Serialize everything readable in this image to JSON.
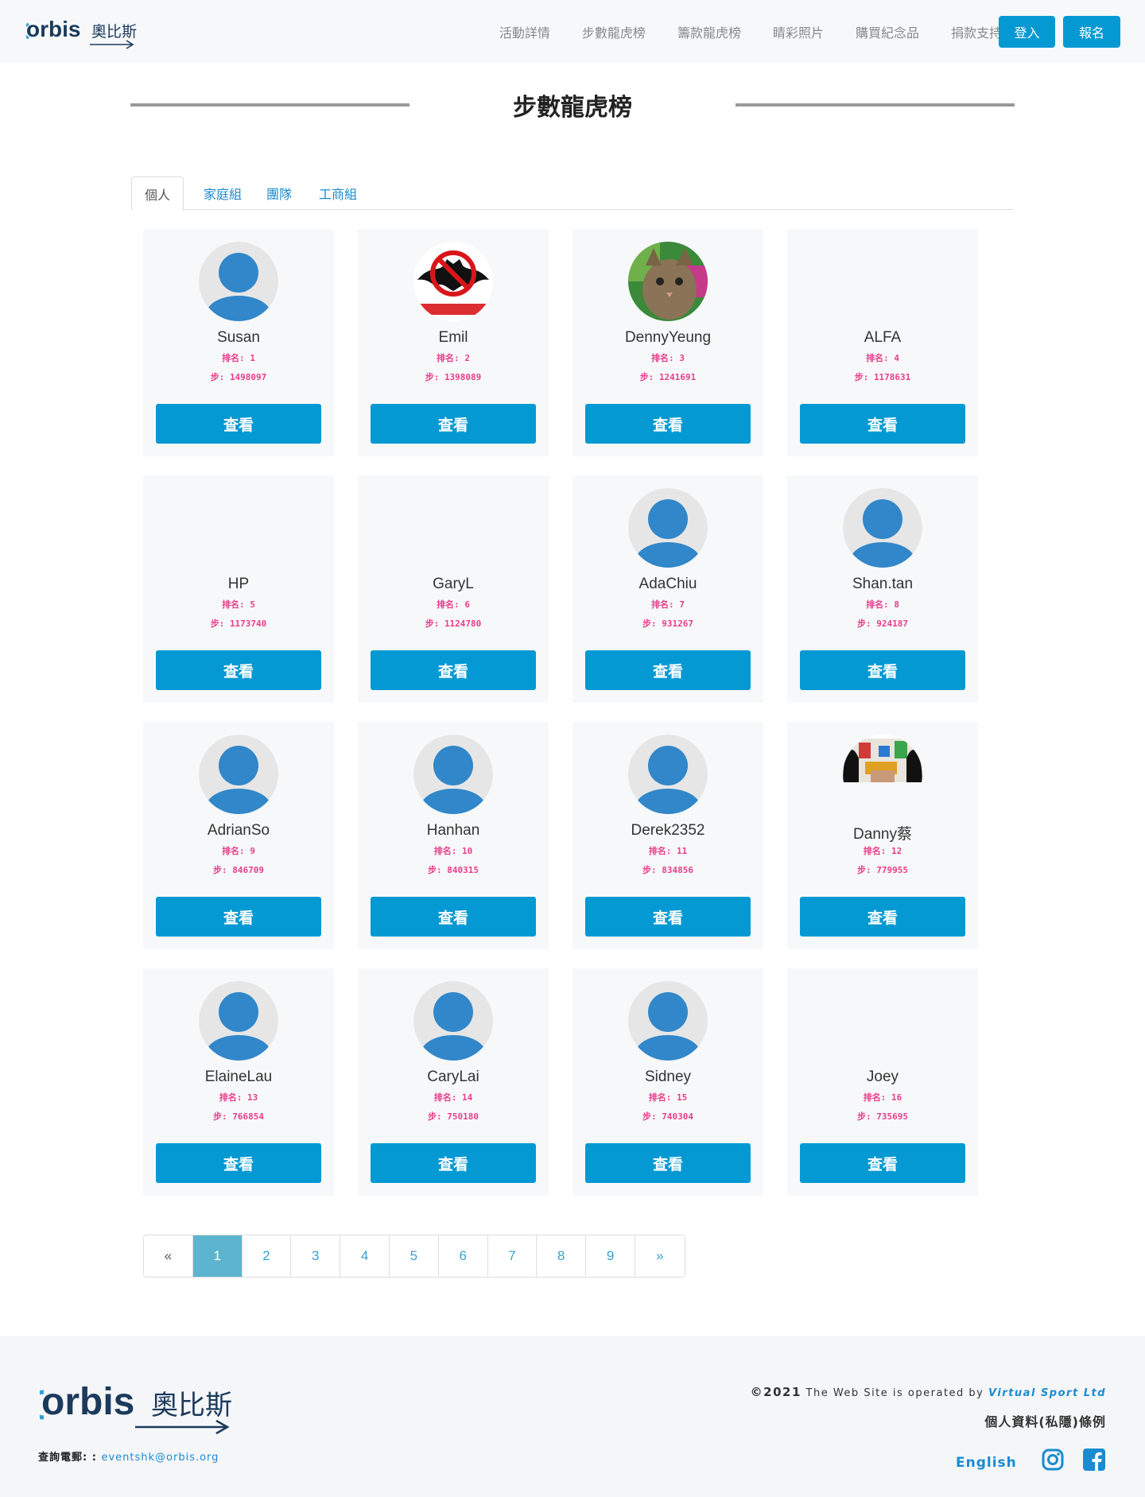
{
  "brand": {
    "wordmark": "orbis",
    "chinese": "奧比斯"
  },
  "nav": {
    "links": [
      "活動詳情",
      "步數龍虎榜",
      "籌款龍虎榜",
      "睛彩照片",
      "購買紀念品",
      "捐款支持"
    ],
    "login": "登入",
    "signup": "報名"
  },
  "page_title": "步數龍虎榜",
  "tabs": [
    "個人",
    "家庭組",
    "團隊",
    "工商組"
  ],
  "active_tab": "個人",
  "rank_label": "排名:",
  "steps_label": "步:",
  "view_button": "查看",
  "cards": [
    {
      "name": "Susan",
      "rank": "1",
      "steps": "1498097",
      "avatar": "default"
    },
    {
      "name": "Emil",
      "rank": "2",
      "steps": "1398089",
      "avatar": "bat-photo"
    },
    {
      "name": "DennyYeung",
      "rank": "3",
      "steps": "1241691",
      "avatar": "cat-photo"
    },
    {
      "name": "ALFA",
      "rank": "4",
      "steps": "1178631",
      "avatar": "none"
    },
    {
      "name": "HP",
      "rank": "5",
      "steps": "1173740",
      "avatar": "none"
    },
    {
      "name": "GaryL",
      "rank": "6",
      "steps": "1124780",
      "avatar": "none"
    },
    {
      "name": "AdaChiu",
      "rank": "7",
      "steps": "931267",
      "avatar": "default"
    },
    {
      "name": "Shan.tan",
      "rank": "8",
      "steps": "924187",
      "avatar": "default"
    },
    {
      "name": "AdrianSo",
      "rank": "9",
      "steps": "846709",
      "avatar": "default"
    },
    {
      "name": "Hanhan",
      "rank": "10",
      "steps": "840315",
      "avatar": "default"
    },
    {
      "name": "Derek2352",
      "rank": "11",
      "steps": "834856",
      "avatar": "default"
    },
    {
      "name": "Danny蔡",
      "rank": "12",
      "steps": "779955",
      "avatar": "colorful-photo"
    },
    {
      "name": "ElaineLau",
      "rank": "13",
      "steps": "766854",
      "avatar": "default"
    },
    {
      "name": "CaryLai",
      "rank": "14",
      "steps": "750180",
      "avatar": "default"
    },
    {
      "name": "Sidney",
      "rank": "15",
      "steps": "740304",
      "avatar": "default"
    },
    {
      "name": "Joey",
      "rank": "16",
      "steps": "735695",
      "avatar": "none"
    }
  ],
  "pagination": {
    "prev": "«",
    "pages": [
      "1",
      "2",
      "3",
      "4",
      "5",
      "6",
      "7",
      "8",
      "9"
    ],
    "next": "»",
    "current": "1"
  },
  "footer": {
    "email_label": "查詢電郵: :",
    "email": "eventshk@orbis.org",
    "copyright_year": "©2021",
    "copyright_text": "The Web Site is operated by",
    "operator": "Virtual Sport Ltd",
    "privacy": "個人資料(私隱)條例",
    "language": "English"
  },
  "colors": {
    "primary": "#0599d3",
    "link": "#1a8bd0",
    "accent_text": "#e83e8c",
    "avatar_blue": "#3187c9",
    "avatar_bg": "#e6e6e6"
  }
}
